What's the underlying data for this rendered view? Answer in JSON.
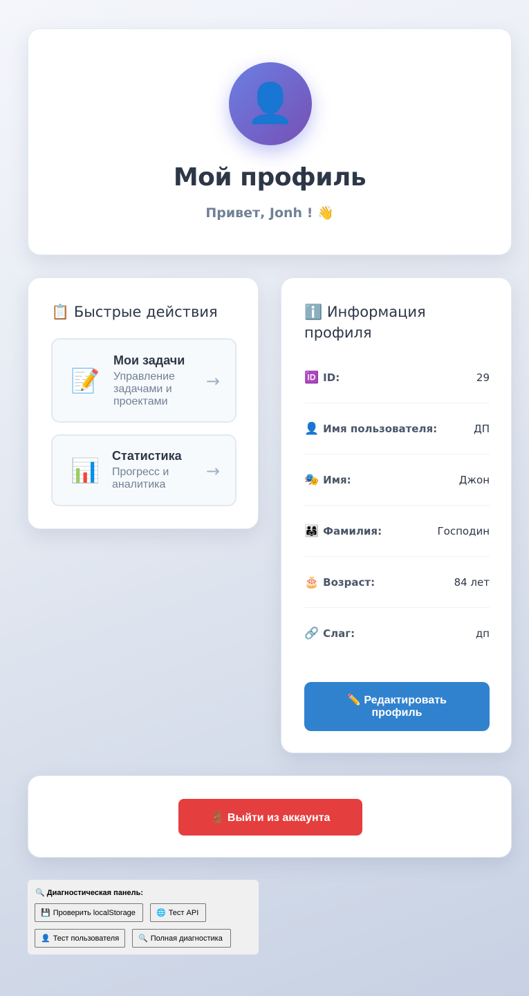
{
  "header": {
    "avatar_icon": "👤",
    "title": "Мой профиль",
    "greeting": "Привет, Jonh ! 👋"
  },
  "quick_actions": {
    "title": "📋 Быстрые действия",
    "items": [
      {
        "icon": "📝",
        "title": "Мои задачи",
        "description": "Управление задачами и проектами",
        "arrow": "→"
      },
      {
        "icon": "📊",
        "title": "Статистика",
        "description": "Прогресс и аналитика",
        "arrow": "→"
      }
    ]
  },
  "profile_info": {
    "title": "ℹ️ Информация профиля",
    "rows": [
      {
        "icon": "🆔",
        "label": "ID:",
        "value": "29"
      },
      {
        "icon": "👤",
        "label": "Имя пользователя:",
        "value": "ДП"
      },
      {
        "icon": "🎭",
        "label": "Имя:",
        "value": "Джон"
      },
      {
        "icon": "👨‍👩‍👧",
        "label": "Фамилия:",
        "value": "Господин"
      },
      {
        "icon": "🎂",
        "label": "Возраст:",
        "value": "84 лет"
      },
      {
        "icon": "🔗",
        "label": "Слаг:",
        "value": "дп"
      }
    ],
    "edit_button": "✏️ Редактировать профиль"
  },
  "logout": {
    "button": "🚪 Выйти из аккаунта"
  },
  "diagnostics": {
    "title": "🔍 Диагностическая панель:",
    "buttons": [
      {
        "icon": "💾",
        "label": "Проверить localStorage"
      },
      {
        "icon": "🌐",
        "label": "Тест API"
      },
      {
        "icon": "👤",
        "label": "Тест пользователя"
      },
      {
        "icon": "🔍",
        "label": "Полная диагностика"
      }
    ]
  },
  "colors": {
    "primary": "#3182ce",
    "danger": "#e53e3e",
    "avatar_gradient_start": "#6b7fe3",
    "avatar_gradient_end": "#7650b5",
    "text_dark": "#2d3748",
    "text_muted": "#718096"
  }
}
